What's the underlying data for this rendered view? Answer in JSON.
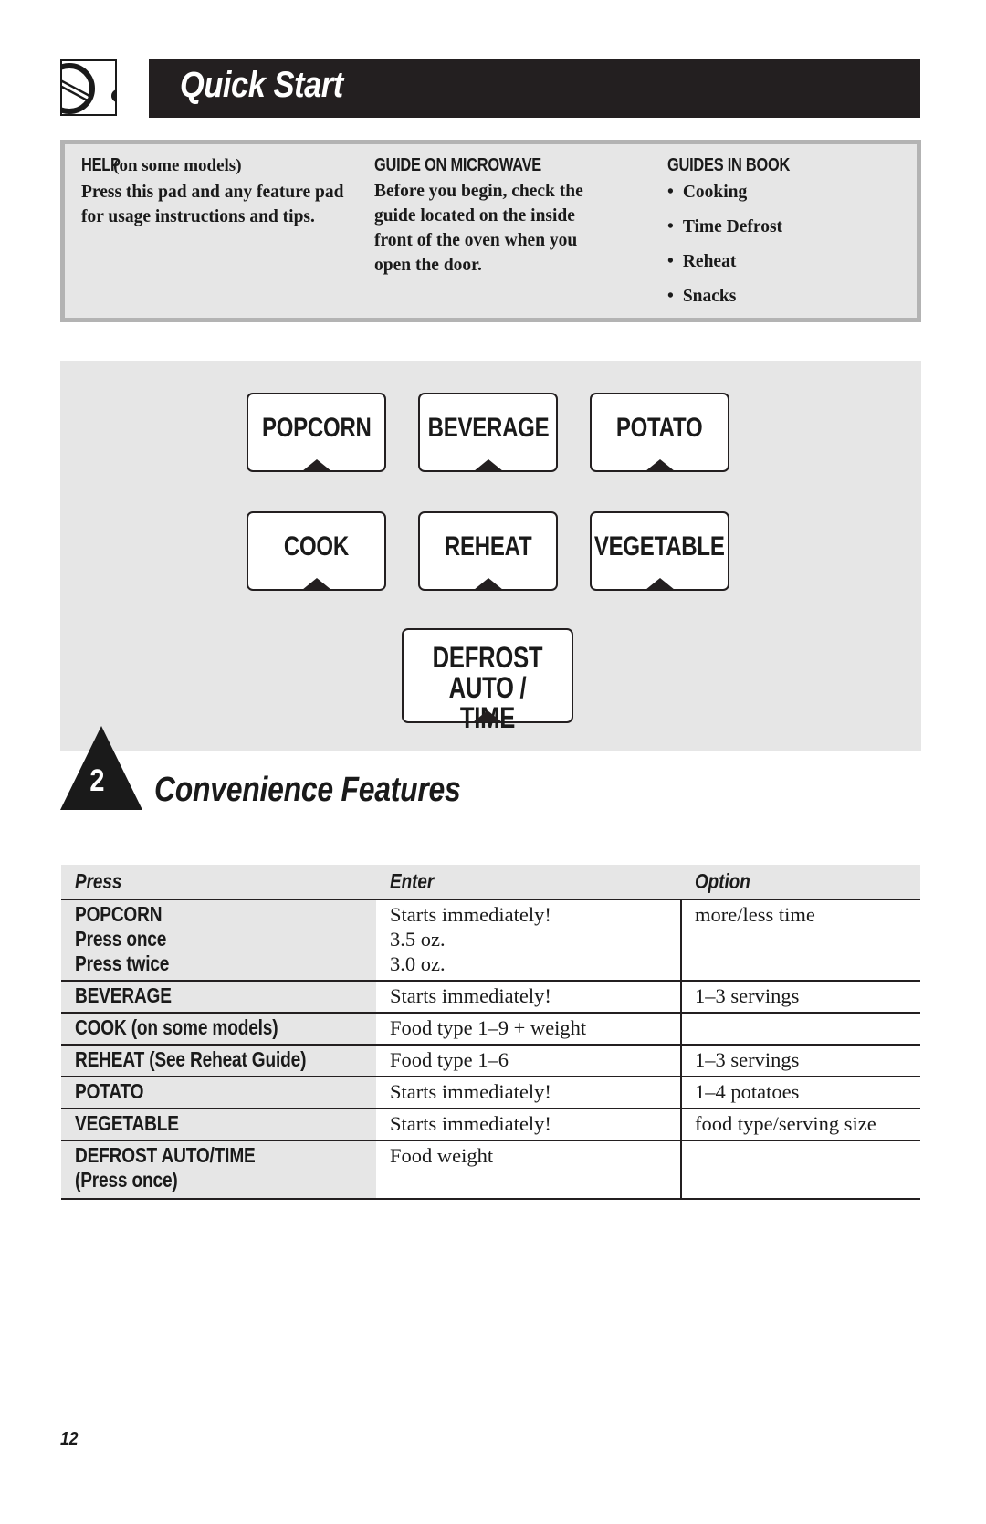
{
  "header": {
    "logo_icon": "dial-knob-icon",
    "title": "Quick Start"
  },
  "info_box": {
    "help": {
      "heading_bold": "HELP",
      "heading_note": "(on some models)",
      "body": "Press this pad and any feature pad for usage instructions and tips."
    },
    "guide_on_microwave": {
      "heading": "GUIDE ON MICROWAVE",
      "body": "Before you begin, check the guide located on the inside front of the oven when you open the door."
    },
    "guides_in_book": {
      "heading": "GUIDES IN BOOK",
      "items": [
        "Cooking",
        "Time Defrost",
        "Reheat",
        "Snacks"
      ]
    }
  },
  "keypad": {
    "keys": [
      {
        "label": "POPCORN"
      },
      {
        "label": "BEVERAGE"
      },
      {
        "label": "POTATO"
      },
      {
        "label": "COOK"
      },
      {
        "label": "REHEAT"
      },
      {
        "label": "VEGETABLE"
      },
      {
        "label_line1": "DEFROST",
        "label_line2": "AUTO / TIME"
      }
    ]
  },
  "section": {
    "number": "2",
    "title": "Convenience Features"
  },
  "table": {
    "headers": [
      "Press",
      "Enter",
      "Option"
    ],
    "rows": [
      {
        "press": [
          "POPCORN",
          "Press once",
          "Press twice"
        ],
        "enter": [
          "Starts immediately!",
          "3.5 oz.",
          "3.0 oz."
        ],
        "option": [
          "more/less time"
        ]
      },
      {
        "press": [
          "BEVERAGE"
        ],
        "enter": [
          "Starts immediately!"
        ],
        "option": [
          "1–3 servings"
        ]
      },
      {
        "press": [
          "COOK (on some models)"
        ],
        "enter": [
          "Food type 1–9 + weight"
        ],
        "option": [
          ""
        ]
      },
      {
        "press": [
          "REHEAT (See Reheat Guide)"
        ],
        "enter": [
          "Food type 1–6"
        ],
        "option": [
          "1–3 servings"
        ]
      },
      {
        "press": [
          "POTATO"
        ],
        "enter": [
          "Starts immediately!"
        ],
        "option": [
          "1–4 potatoes"
        ]
      },
      {
        "press": [
          "VEGETABLE"
        ],
        "enter": [
          "Starts immediately!"
        ],
        "option": [
          "food type/serving size"
        ]
      },
      {
        "press": [
          "DEFROST AUTO/TIME",
          "(Press once)"
        ],
        "enter": [
          "Food weight"
        ],
        "option": [
          ""
        ]
      }
    ]
  },
  "footer": {
    "page_number": "12"
  }
}
